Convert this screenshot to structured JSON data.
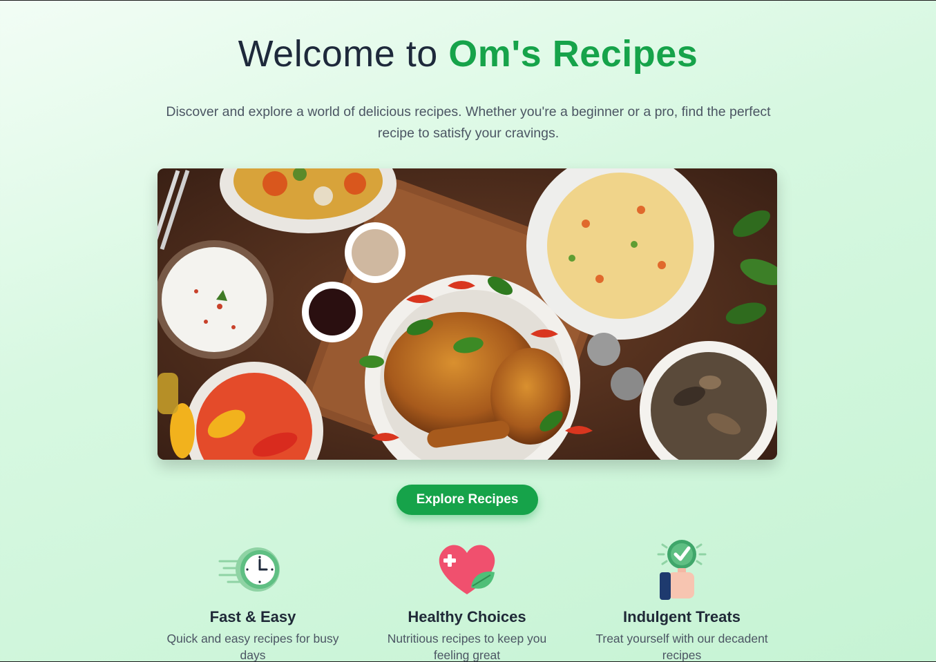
{
  "hero": {
    "title_prefix": "Welcome to",
    "title_accent": "Om's Recipes",
    "subtitle": "Discover and explore a world of delicious recipes. Whether you're a beginner or a pro, find the perfect recipe to satisfy your cravings.",
    "cta_label": "Explore Recipes"
  },
  "features": [
    {
      "icon": "clock-icon",
      "title": "Fast & Easy",
      "description": "Quick and easy recipes for busy days"
    },
    {
      "icon": "heart-icon",
      "title": "Healthy Choices",
      "description": "Nutritious recipes to keep you feeling great"
    },
    {
      "icon": "thumbs-up-icon",
      "title": "Indulgent Treats",
      "description": "Treat yourself with our decadent recipes"
    }
  ],
  "colors": {
    "accent": "#16a34a",
    "background": "#d7f8e1",
    "text": "#1e293b"
  }
}
